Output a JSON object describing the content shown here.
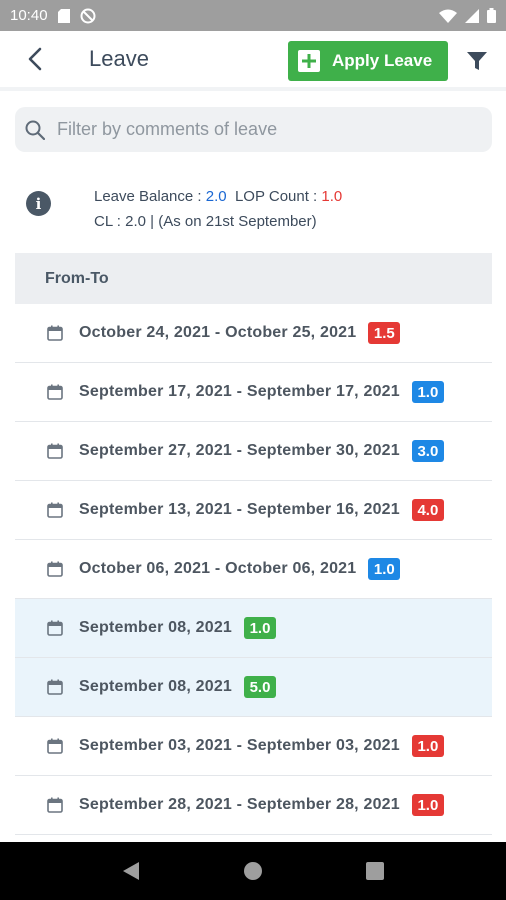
{
  "status_bar": {
    "time": "10:40"
  },
  "app_bar": {
    "title": "Leave",
    "apply_label": "Apply Leave"
  },
  "search": {
    "placeholder": "Filter by comments of leave"
  },
  "balance": {
    "leave_balance_label": "Leave Balance :",
    "leave_balance_value": "2.0",
    "lop_label": "LOP Count :",
    "lop_value": "1.0",
    "cl_line": "CL : 2.0 | (As on 21st September)"
  },
  "table": {
    "header": "From-To",
    "rows": [
      {
        "dates": "October 24, 2021 - October 25, 2021",
        "days": "1.5",
        "badge_color": "#e53935",
        "highlight": false
      },
      {
        "dates": "September 17, 2021 - September 17, 2021",
        "days": "1.0",
        "badge_color": "#1e88e5",
        "highlight": false
      },
      {
        "dates": "September 27, 2021 - September 30, 2021",
        "days": "3.0",
        "badge_color": "#1e88e5",
        "highlight": false
      },
      {
        "dates": "September 13, 2021 - September 16, 2021",
        "days": "4.0",
        "badge_color": "#e53935",
        "highlight": false
      },
      {
        "dates": "October 06, 2021 - October 06, 2021",
        "days": "1.0",
        "badge_color": "#1e88e5",
        "highlight": false
      },
      {
        "dates": "September 08, 2021",
        "days": "1.0",
        "badge_color": "#3fb04a",
        "highlight": true
      },
      {
        "dates": "September 08, 2021",
        "days": "5.0",
        "badge_color": "#3fb04a",
        "highlight": true
      },
      {
        "dates": "September 03, 2021 - September 03, 2021",
        "days": "1.0",
        "badge_color": "#e53935",
        "highlight": false
      },
      {
        "dates": "September 28, 2021 - September 28, 2021",
        "days": "1.0",
        "badge_color": "#e53935",
        "highlight": false
      }
    ]
  },
  "colors": {
    "accent_green": "#3fb04a",
    "blue": "#1e88e5",
    "red": "#e53935",
    "highlight_bg": "#eaf4fb"
  },
  "icons": {
    "back": "back-arrow-icon",
    "plus": "plus-icon",
    "filter": "filter-icon",
    "search": "search-icon",
    "info": "info-icon",
    "calendar": "calendar-icon"
  }
}
